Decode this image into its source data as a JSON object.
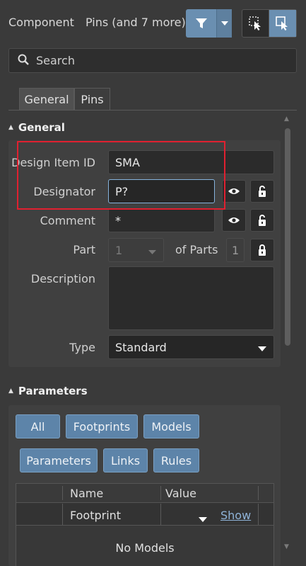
{
  "header": {
    "kind": "Component",
    "filter_summary": "Pins (and 7 more)"
  },
  "search": {
    "placeholder": "Search"
  },
  "tabs": [
    {
      "label": "General",
      "active": true
    },
    {
      "label": "Pins",
      "active": false
    }
  ],
  "general": {
    "title": "General",
    "design_item_id_label": "Design Item ID",
    "design_item_id_value": "SMA",
    "designator_label": "Designator",
    "designator_value": "P?",
    "comment_label": "Comment",
    "comment_value": "*",
    "part_label": "Part",
    "part_value": "1",
    "of_parts_label": "of Parts",
    "of_parts_value": "1",
    "description_label": "Description",
    "description_value": "",
    "type_label": "Type",
    "type_value": "Standard"
  },
  "parameters": {
    "title": "Parameters",
    "filters": [
      "All",
      "Footprints",
      "Models",
      "Parameters",
      "Links",
      "Rules"
    ],
    "columns": [
      "Name",
      "Value"
    ],
    "rows": [
      {
        "name": "Footprint",
        "value": "",
        "action": "Show"
      }
    ],
    "empty_text": "No Models"
  },
  "colors": {
    "accent": "#6a8fb1",
    "highlight_box": "#e02030",
    "focus_border": "#86b3dd"
  }
}
